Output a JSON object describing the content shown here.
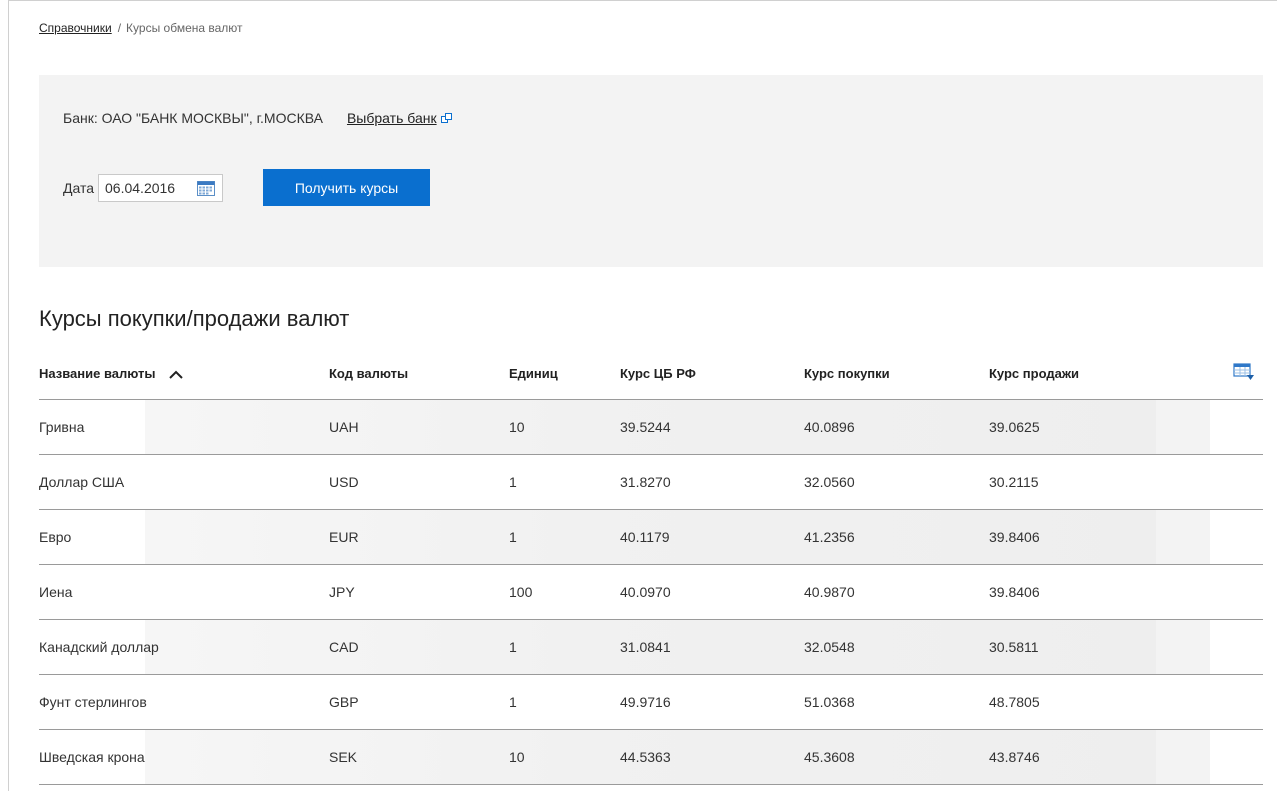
{
  "breadcrumb": {
    "link": "Справочники",
    "separator": "/",
    "current": "Курсы обмена валют"
  },
  "filter": {
    "bank_text": "Банк: ОАО \"БАНК МОСКВЫ\", г.МОСКВА",
    "choose_bank_label": "Выбрать банк",
    "date_label": "Дата",
    "date_value": "06.04.2016",
    "submit_label": "Получить курсы"
  },
  "section_title": "Курсы покупки/продажи валют",
  "table": {
    "headers": {
      "name": "Название валюты",
      "code": "Код валюты",
      "units": "Единиц",
      "cb_rate": "Курс ЦБ РФ",
      "buy_rate": "Курс покупки",
      "sell_rate": "Курс продажи"
    },
    "sort": "name-ascending",
    "rows": [
      {
        "name": "Гривна",
        "code": "UAH",
        "units": "10",
        "cb_rate": "39.5244",
        "buy_rate": "40.0896",
        "sell_rate": "39.0625"
      },
      {
        "name": "Доллар США",
        "code": "USD",
        "units": "1",
        "cb_rate": "31.8270",
        "buy_rate": "32.0560",
        "sell_rate": "30.2115"
      },
      {
        "name": "Евро",
        "code": "EUR",
        "units": "1",
        "cb_rate": "40.1179",
        "buy_rate": "41.2356",
        "sell_rate": "39.8406"
      },
      {
        "name": "Иена",
        "code": "JPY",
        "units": "100",
        "cb_rate": "40.0970",
        "buy_rate": "40.9870",
        "sell_rate": "39.8406"
      },
      {
        "name": "Канадский доллар",
        "code": "CAD",
        "units": "1",
        "cb_rate": "31.0841",
        "buy_rate": "32.0548",
        "sell_rate": "30.5811"
      },
      {
        "name": "Фунт стерлингов",
        "code": "GBP",
        "units": "1",
        "cb_rate": "49.9716",
        "buy_rate": "51.0368",
        "sell_rate": "48.7805"
      },
      {
        "name": "Шведская крона",
        "code": "SEK",
        "units": "10",
        "cb_rate": "44.5363",
        "buy_rate": "45.3608",
        "sell_rate": "43.8746"
      }
    ]
  },
  "icons": {
    "external_link": "external-link-icon",
    "calendar": "calendar-icon",
    "sort": "chevron-up-icon",
    "export": "table-export-icon"
  },
  "colors": {
    "accent": "#0a6fcf",
    "panel_bg": "#f3f3f3",
    "row_divider": "#9a9a9a"
  }
}
